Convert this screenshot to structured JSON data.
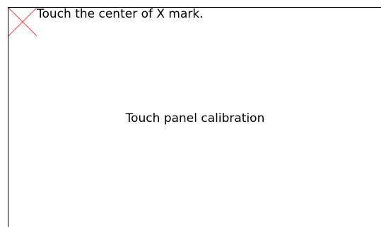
{
  "calibration": {
    "instruction": "Touch the center of X mark.",
    "title": "Touch panel calibration",
    "target_icon": "x-mark-icon",
    "target_color": "#ff3b3b"
  }
}
